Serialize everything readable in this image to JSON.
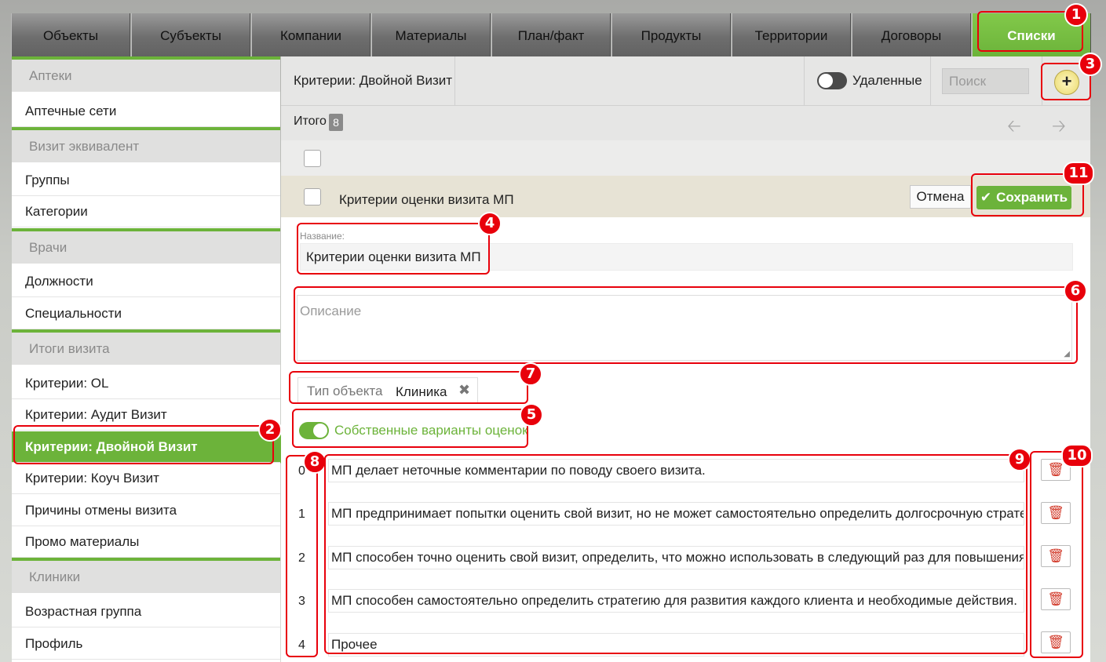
{
  "tabs": [
    {
      "label": "Объекты",
      "active": false
    },
    {
      "label": "Субъекты",
      "active": false
    },
    {
      "label": "Компании",
      "active": false
    },
    {
      "label": "Материалы",
      "active": false
    },
    {
      "label": "План/факт",
      "active": false
    },
    {
      "label": "Продукты",
      "active": false
    },
    {
      "label": "Территории",
      "active": false
    },
    {
      "label": "Договоры",
      "active": false
    },
    {
      "label": "Списки",
      "active": true
    }
  ],
  "sidebar": {
    "groups": [
      {
        "header": "Аптеки",
        "items": [
          "Аптечные сети"
        ]
      },
      {
        "header": "Визит эквивалент",
        "items": [
          "Группы",
          "Категории"
        ]
      },
      {
        "header": "Врачи",
        "items": [
          "Должности",
          "Специальности"
        ]
      },
      {
        "header": "Итоги визита",
        "items": [
          "Критерии: OL",
          "Критерии: Аудит Визит",
          "Критерии: Двойной Визит",
          "Критерии: Коуч Визит",
          "Причины отмены визита",
          "Промо материалы"
        ]
      },
      {
        "header": "Клиники",
        "items": [
          "Возрастная группа",
          "Профиль"
        ]
      }
    ],
    "active_item": "Критерии: Двойной Визит"
  },
  "header": {
    "title": "Критерии: Двойной Визит",
    "deleted_label": "Удаленные",
    "search_placeholder": "Поиск",
    "add_icon": "plus-icon"
  },
  "summary": {
    "total_label": "Итого",
    "total_count": "8",
    "prev_icon": "arrow-left-icon",
    "next_icon": "arrow-right-icon"
  },
  "edit_row": {
    "title": "Критерии оценки визита МП",
    "cancel_label": "Отмена",
    "save_label": "Сохранить"
  },
  "form": {
    "name_label": "Название:",
    "name_value": "Критерии оценки визита МП",
    "description_placeholder": "Описание",
    "object_type_label": "Тип объекта",
    "object_type_value": "Клиника",
    "own_options_label": "Собственные варианты оценок",
    "own_options_enabled": true
  },
  "options": [
    {
      "num": "0",
      "text": "МП делает неточные комментарии по поводу  своего визита."
    },
    {
      "num": "1",
      "text": "МП предпринимает попытки оценить свой визит, но не может самостоятельно определить долгосрочную стратегию р"
    },
    {
      "num": "2",
      "text": "МП способен точно оценить свой визит, определить,  что можно использовать  в следующий раз для повышения резул"
    },
    {
      "num": "3",
      "text": "МП способен самостоятельно определить стратегию для развития каждого клиента и необходимые действия."
    },
    {
      "num": "4",
      "text": "Прочее"
    }
  ],
  "annotations": [
    "1",
    "2",
    "3",
    "4",
    "5",
    "6",
    "7",
    "8",
    "9",
    "10",
    "11"
  ],
  "colors": {
    "accent": "#6cb33a",
    "annotation": "#e8000b"
  }
}
